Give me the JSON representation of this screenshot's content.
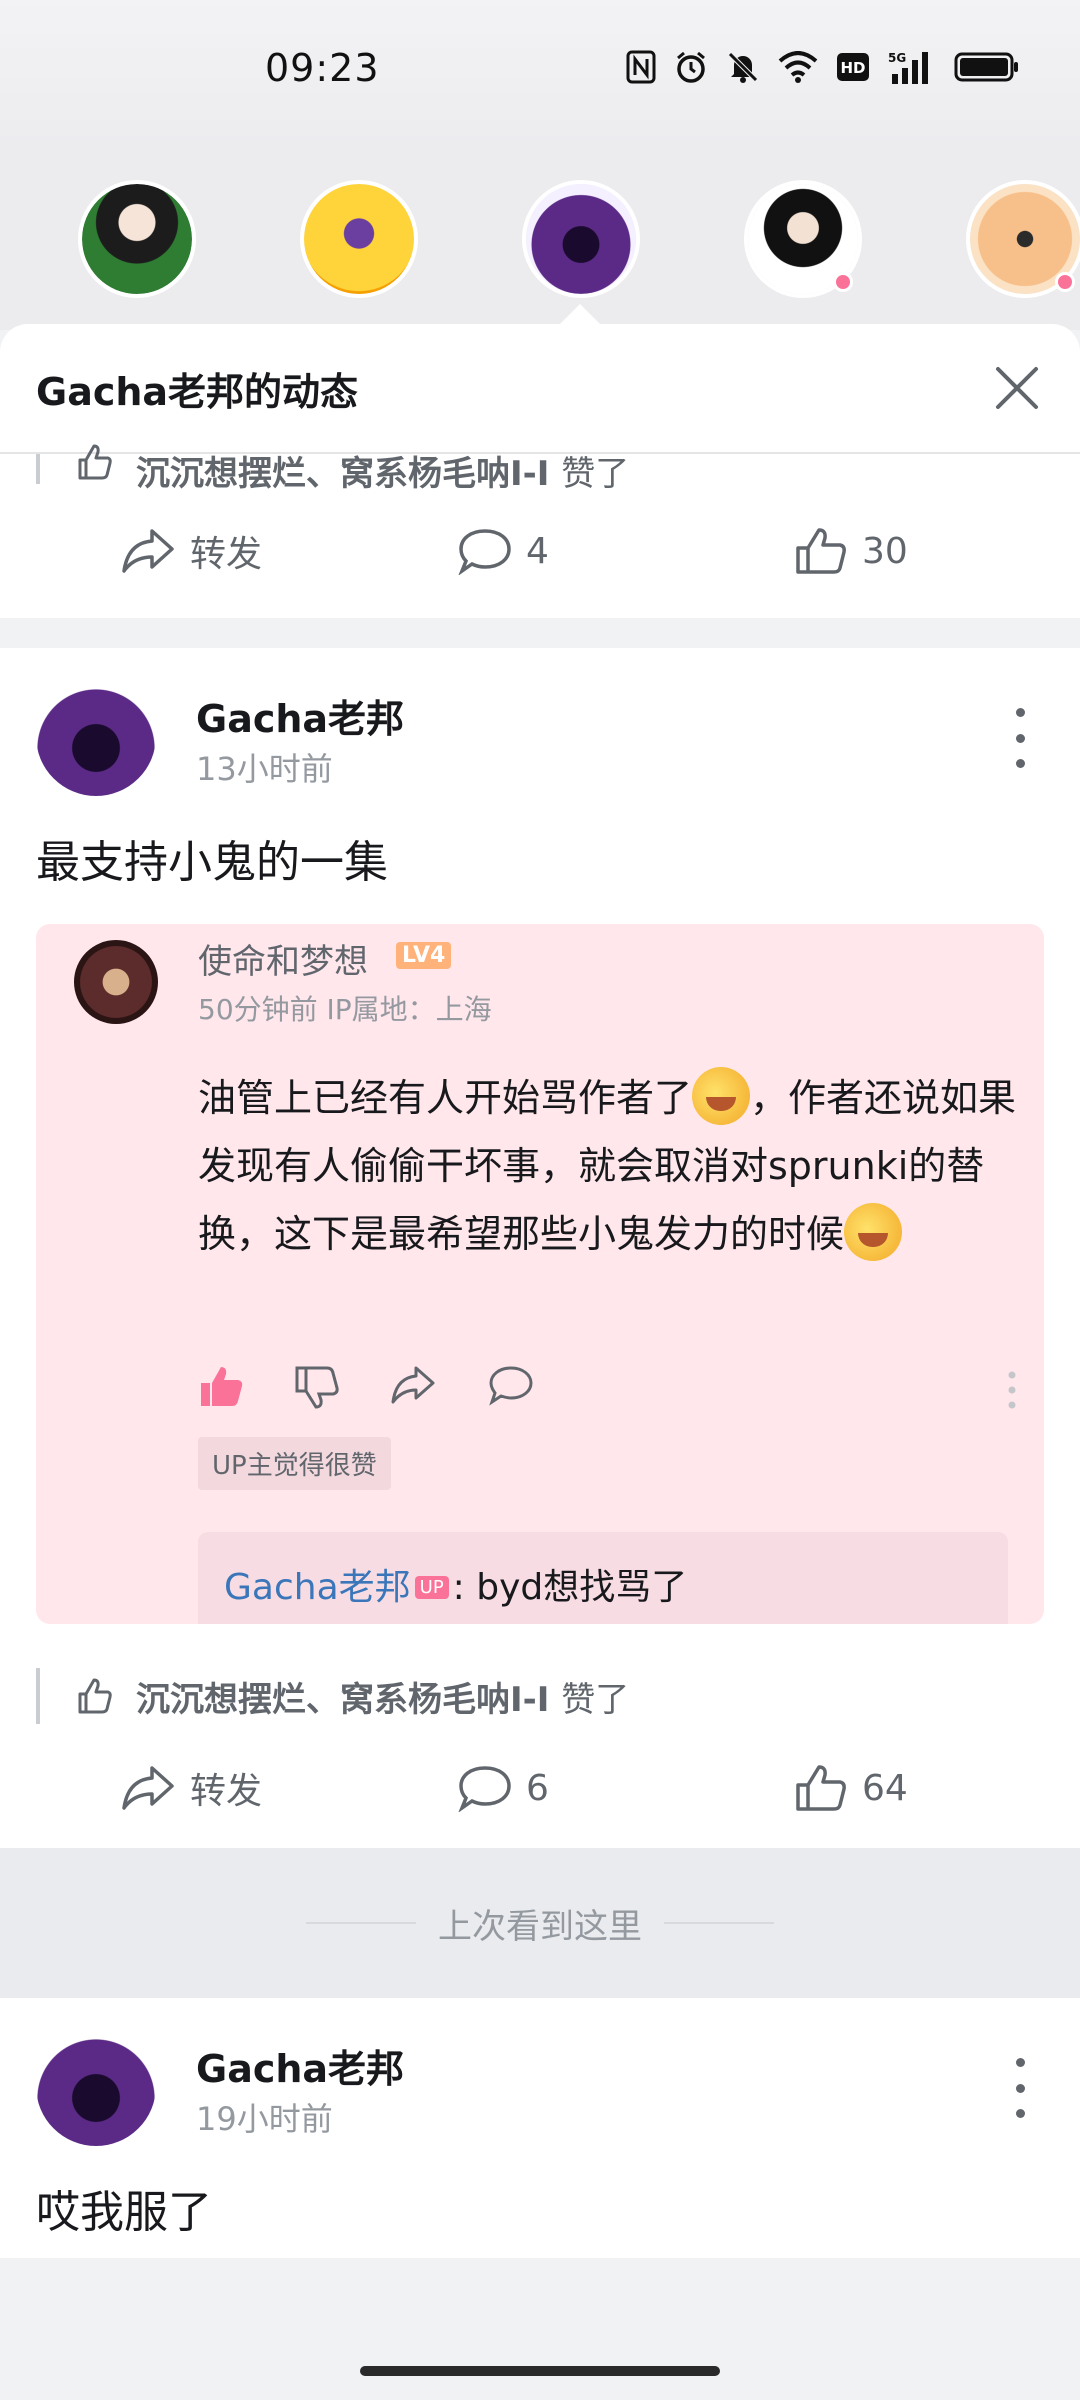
{
  "status": {
    "time": "09:23",
    "icons": [
      "nfc-icon",
      "alarm-icon",
      "mute-icon",
      "wifi-icon",
      "hd-icon",
      "5g-signal-icon",
      "battery-icon"
    ]
  },
  "colors": {
    "accent_pink": "#fb7299",
    "link_blue": "#3a76b9",
    "quote_bg": "#ffe7ec"
  },
  "panel": {
    "title": "Gacha老邦的动态"
  },
  "prev_post": {
    "liked_by": "沉沉想摆烂、窝系杨毛呐I-I",
    "liked_suffix": "赞了",
    "forward_label": "转发",
    "comments": "4",
    "likes": "30"
  },
  "post1": {
    "author": "Gacha老邦",
    "time": "13小时前",
    "text": "最支持小鬼的一集",
    "quote": {
      "name": "使命和梦想",
      "level": "LV4",
      "meta": "50分钟前 IP属地：上海",
      "body_part1": "油管上已经有人开始骂作者了",
      "body_part2": "，作者还说如果发现有人偷偷干坏事，就会取消对sprunki的替换，这下是最希望那些小鬼发力的时候",
      "up_tag": "UP主觉得很赞",
      "reply_author": "Gacha老邦",
      "reply_badge": "UP",
      "reply_text": ": byd想找骂了"
    },
    "liked_by": "沉沉想摆烂、窝系杨毛呐I-I",
    "liked_suffix": "赞了",
    "forward_label": "转发",
    "comments": "6",
    "likes": "64"
  },
  "divider": {
    "label": "上次看到这里"
  },
  "post2": {
    "author": "Gacha老邦",
    "time": "19小时前",
    "text": "哎我服了"
  }
}
